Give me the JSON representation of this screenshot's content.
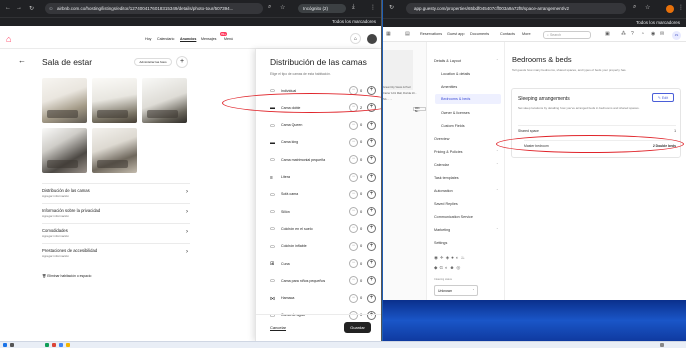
{
  "left_browser": {
    "url": "airbnb.com.co/hosting/listings/editor/1274004176018315349/details/photo-tour/507394...",
    "incognito_label": "Incógnito (2)",
    "bookmarks_label": "Todos los marcadores",
    "nav": {
      "hoy": "Hoy",
      "calendario": "Calendario",
      "anuncios": "Anuncios",
      "mensajes": "Mensajes",
      "menu": "Menú",
      "mensajes_badge": "99+"
    },
    "room_title": "Sala de estar",
    "admin_photos_button": "Administrar las fotos",
    "sections": [
      {
        "title": "Distribución de las camas",
        "subtitle": "Agregar información"
      },
      {
        "title": "Información sobre la privacidad",
        "subtitle": "Agregar información"
      },
      {
        "title": "Comodidades",
        "subtitle": "Agregar información"
      },
      {
        "title": "Prestaciones de accesibilidad",
        "subtitle": "Agregar información"
      }
    ],
    "delete_room": "Eliminar habitación o espacio",
    "modal": {
      "title": "Distribución de las camas",
      "subtitle": "Elige el tipo de camas de esta habitación.",
      "beds": [
        {
          "label": "Individual",
          "count": "0"
        },
        {
          "label": "Cama doble",
          "count": "2"
        },
        {
          "label": "Cama Queen",
          "count": "0"
        },
        {
          "label": "Cama king",
          "count": "0"
        },
        {
          "label": "Cama matrimonial pequeña",
          "count": "0"
        },
        {
          "label": "Litera",
          "count": "0"
        },
        {
          "label": "Sofá cama",
          "count": "0"
        },
        {
          "label": "Sillón",
          "count": "0"
        },
        {
          "label": "Colchón en el suelo",
          "count": "0"
        },
        {
          "label": "Colchón inflable",
          "count": "0"
        },
        {
          "label": "Cuna",
          "count": "0"
        },
        {
          "label": "Cama para niños pequeños",
          "count": "0"
        },
        {
          "label": "Hamaca",
          "count": "0"
        },
        {
          "label": "Cama de agua",
          "count": "0"
        }
      ],
      "cancel": "Cancelar",
      "save": "Guardar"
    }
  },
  "right_browser": {
    "url": "app.guesty.com/properties/65bdf045407cff003a9a72f8/space-arrangement/v2",
    "bookmarks_label": "Todos los marcadores",
    "nav": [
      "Reservations",
      "Guest app",
      "Documents",
      "Contacts",
      "More"
    ],
    "search_placeholder": "Search",
    "avatar": "JS",
    "left_column": {
      "lines": [
        "Great City Views & Pool",
        "Carrer 12/1 Mall, Florida 10...",
        "NA ... ..."
      ],
      "chip": "With Be..."
    },
    "menu": {
      "details_layout": "Details & Layout",
      "location": "Location & details",
      "amenities": "Amenities",
      "bedrooms": "Bedrooms & beds",
      "owner": "Owner & licenses",
      "custom": "Custom Fields",
      "overview": "Overview",
      "pricing": "Pricing & Policies",
      "calendar": "Calendar",
      "task_templates": "Task templates",
      "automation": "Automation",
      "saved_replies": "Saved Replies",
      "communication": "Communication Service",
      "marketing": "Marketing",
      "settings": "Settings",
      "cleaning_label": "Cleaning status",
      "cleaning_value": "Unknown"
    },
    "detail": {
      "title": "Bedrooms & beds",
      "subtitle": "Tell guests how many bedrooms, shared spaces, and types of beds your property has.",
      "card_title": "Sleeping arrangements",
      "edit": "Edit",
      "card_desc": "Set sleep locations by detailing how you've arranged beds in bedrooms and shared spaces.",
      "shared_label": "Shared space",
      "shared_value": "1",
      "master_label": "Master bedroom",
      "master_value": "2 Double beds"
    }
  }
}
